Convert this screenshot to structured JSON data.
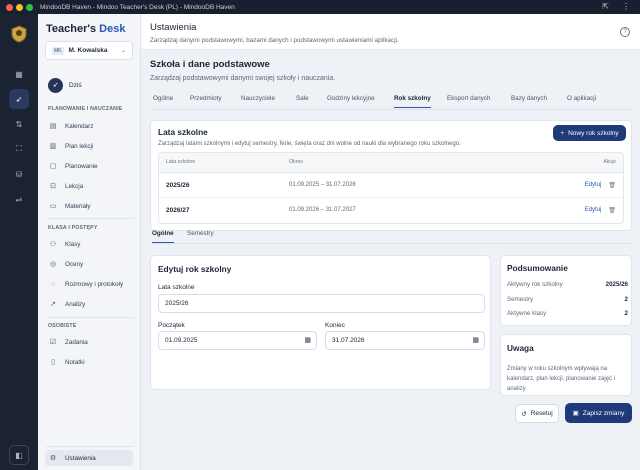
{
  "window": {
    "title": "MindooDB Haven - Mindoo Teacher's Desk (PL) - MindooDB Haven"
  },
  "app": {
    "brand_prefix": "Teacher's ",
    "brand_suffix": "Desk"
  },
  "user": {
    "initials": "MK",
    "name": "M. Kowalska"
  },
  "sidebar": {
    "today": "Dziś",
    "section_planning": "PLANOWANIE I NAUCZANIE",
    "planning_items": [
      "Kalendarz",
      "Plan lekcji",
      "Planowanie",
      "Lekcja",
      "Materiały"
    ],
    "section_classes": "KLASA I POSTĘPY",
    "class_items": [
      "Klasy",
      "Oceny",
      "Rozmowy i protokoły",
      "Analizy"
    ],
    "section_personal": "OSOBISTE",
    "personal_items": [
      "Zadania",
      "Notatki"
    ],
    "settings": "Ustawienia"
  },
  "header": {
    "title": "Ustawienia",
    "subtitle": "Zarządzaj danymi podstawowymi, bazami danych i podstawowymi ustawieniami aplikacji."
  },
  "section": {
    "title": "Szkoła i dane podstawowe",
    "subtitle": "Zarządzaj podstawowymi danymi swojej szkoły i nauczania."
  },
  "tabs": [
    "Ogólne",
    "Przedmioty",
    "Nauczyciele",
    "Sale",
    "Godziny lekcyjne",
    "Rok szkolny",
    "Eksport danych",
    "Bazy danych",
    "O aplikacji"
  ],
  "active_tab": "Rok szkolny",
  "school_years": {
    "title": "Lata szkolne",
    "subtitle": "Zarządzaj latami szkolnymi i edytuj semestry, ferie, święta oraz dni wolne od nauki dla wybranego roku szkolnego.",
    "new_button": "Nowy rok szkolny",
    "columns": {
      "year": "Lata szkolne",
      "period": "Okres",
      "actions": "Akcje"
    },
    "rows": [
      {
        "year": "2025/26",
        "period": "01.09.2025 – 31.07.2026",
        "action": "Edytuj"
      },
      {
        "year": "2026/27",
        "period": "01.09.2026 – 31.07.2027",
        "action": "Edytuj"
      }
    ]
  },
  "subtabs": [
    "Ogólne",
    "Semestry"
  ],
  "edit": {
    "title": "Edytuj rok szkolny",
    "year_label": "Lata szkolne",
    "year_value": "2025/26",
    "start_label": "Początek",
    "start_value": "01.09.2025",
    "end_label": "Koniec",
    "end_value": "31.07.2026"
  },
  "summary": {
    "title": "Podsumowanie",
    "active_year_label": "Aktywny rok szkolny",
    "active_year_value": "2025/26",
    "semesters_label": "Semestry",
    "semesters_value": "2",
    "active_classes_label": "Aktywne klasy",
    "active_classes_value": "2"
  },
  "note": {
    "title": "Uwaga",
    "text": "Zmiany w roku szkolnym wpływają na kalendarz, plan lekcji, planowanie zajęć i analizy."
  },
  "footer": {
    "reset": "Resetuj",
    "save": "Zapisz zmiany"
  },
  "colors": {
    "accent": "#1e3a78",
    "link": "#2a57b5",
    "rail": "#1b2232"
  }
}
